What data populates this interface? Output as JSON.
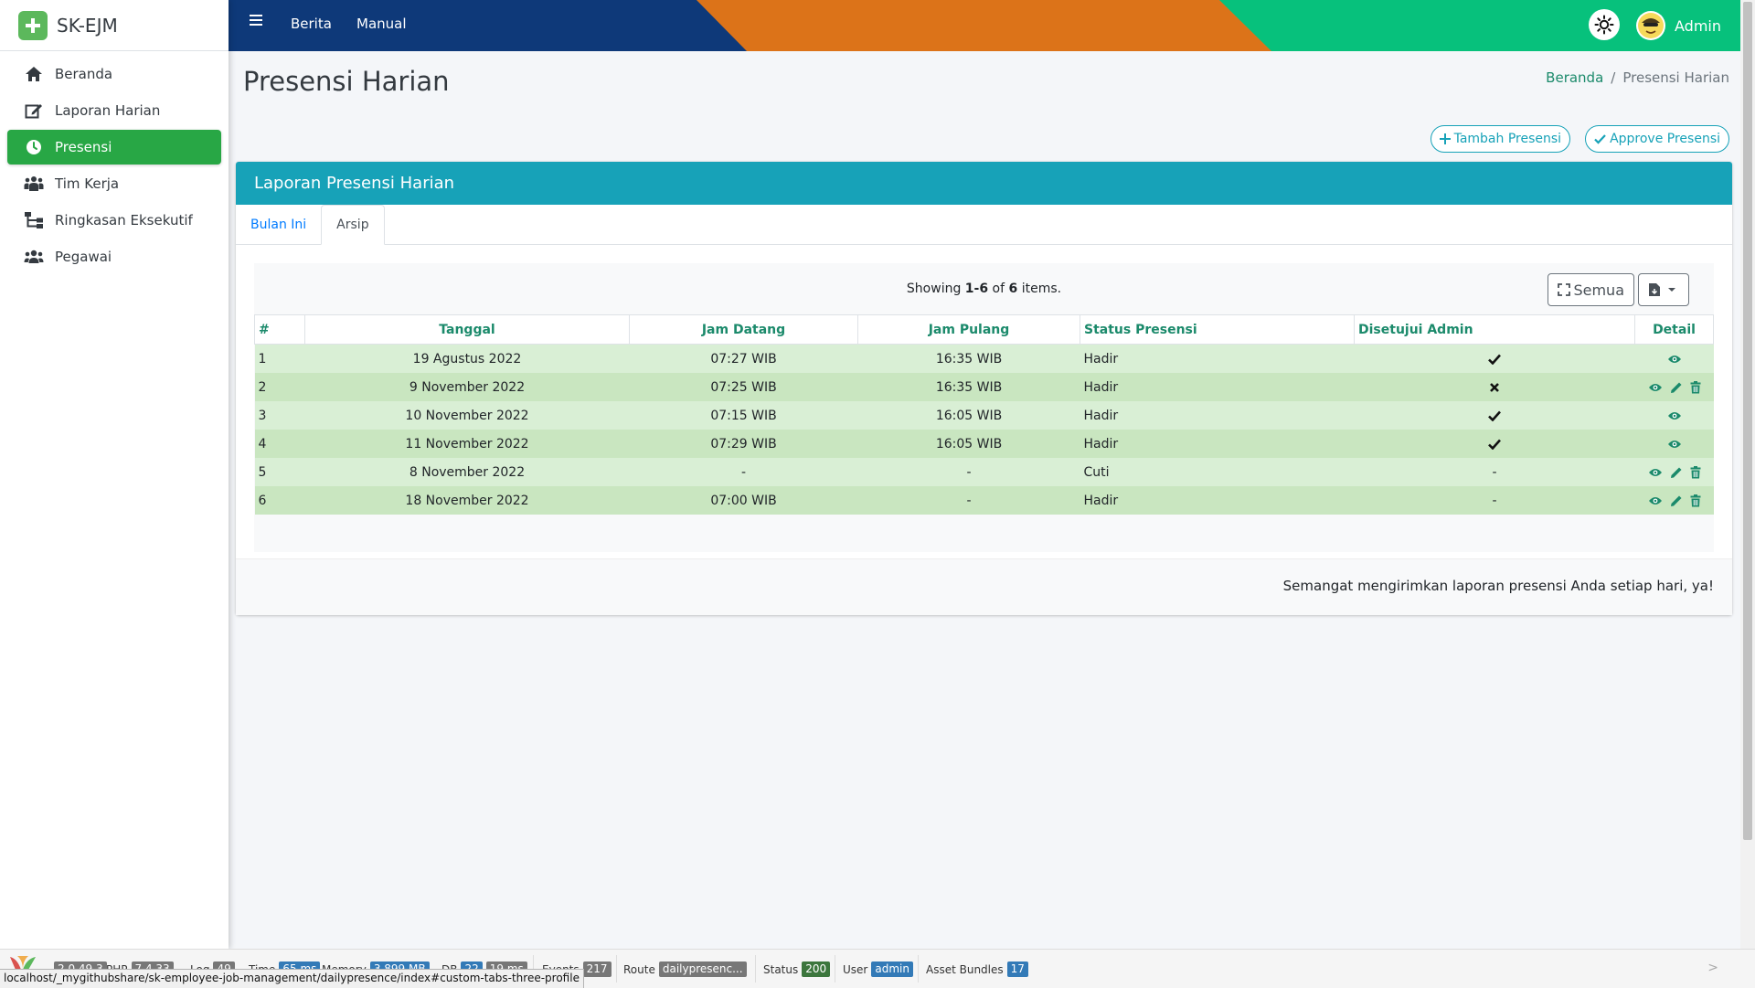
{
  "brand": {
    "name": "SK-EJM"
  },
  "sidebar": {
    "items": [
      {
        "label": "Beranda",
        "icon": "home-icon",
        "active": false
      },
      {
        "label": "Laporan Harian",
        "icon": "edit-icon",
        "active": false
      },
      {
        "label": "Presensi",
        "icon": "clock-icon",
        "active": true
      },
      {
        "label": "Tim Kerja",
        "icon": "team-icon",
        "active": false
      },
      {
        "label": "Ringkasan Eksekutif",
        "icon": "sitemap-icon",
        "active": false
      },
      {
        "label": "Pegawai",
        "icon": "users-icon",
        "active": false
      }
    ]
  },
  "topbar": {
    "links": [
      "Berita",
      "Manual"
    ],
    "user": "Admin",
    "colors": {
      "navy": "#0e3979",
      "orange": "#dc7319",
      "green": "#07c17c"
    }
  },
  "page": {
    "title": "Presensi Harian",
    "breadcrumb": {
      "home": "Beranda",
      "current": "Presensi Harian"
    }
  },
  "actions": {
    "add": "Tambah Presensi",
    "approve": "Approve Presensi"
  },
  "card": {
    "title": "Laporan Presensi Harian",
    "tabs": [
      {
        "label": "Bulan Ini",
        "active": false
      },
      {
        "label": "Arsip",
        "active": true
      }
    ],
    "summary": {
      "prefix": "Showing ",
      "range": "1-6",
      "middle": " of ",
      "total": "6",
      "suffix": " items."
    },
    "toolbar": {
      "all_label": "Semua"
    },
    "footer_note": "Semangat mengirimkan laporan presensi Anda setiap hari, ya!"
  },
  "table": {
    "columns": [
      "#",
      "Tanggal",
      "Jam Datang",
      "Jam Pulang",
      "Status Presensi",
      "Disetujui Admin",
      "Detail"
    ],
    "rows": [
      {
        "no": "1",
        "tanggal": "19 Agustus 2022",
        "datang": "07:27 WIB",
        "pulang": "16:35 WIB",
        "status": "Hadir",
        "approved": "check",
        "actions": [
          "view"
        ]
      },
      {
        "no": "2",
        "tanggal": "9 November 2022",
        "datang": "07:25 WIB",
        "pulang": "16:35 WIB",
        "status": "Hadir",
        "approved": "cross",
        "actions": [
          "view",
          "edit",
          "delete"
        ]
      },
      {
        "no": "3",
        "tanggal": "10 November 2022",
        "datang": "07:15 WIB",
        "pulang": "16:05 WIB",
        "status": "Hadir",
        "approved": "check",
        "actions": [
          "view"
        ]
      },
      {
        "no": "4",
        "tanggal": "11 November 2022",
        "datang": "07:29 WIB",
        "pulang": "16:05 WIB",
        "status": "Hadir",
        "approved": "check",
        "actions": [
          "view"
        ]
      },
      {
        "no": "5",
        "tanggal": "8 November 2022",
        "datang": "-",
        "pulang": "-",
        "status": "Cuti",
        "approved": "-",
        "actions": [
          "view",
          "edit",
          "delete"
        ]
      },
      {
        "no": "6",
        "tanggal": "18 November 2022",
        "datang": "07:00 WIB",
        "pulang": "-",
        "status": "Hadir",
        "approved": "-",
        "actions": [
          "view",
          "edit",
          "delete"
        ]
      }
    ]
  },
  "debugbar": {
    "yii": "2.0.49.3",
    "php_label": "PHP",
    "php": "7.4.33",
    "log_label": "Log",
    "log": "49",
    "time_label": "Time",
    "time": "65 ms",
    "memory_label": "Memory",
    "memory": "3.899 MB",
    "db_label": "DB",
    "db_count": "22",
    "db_time": "19 ms",
    "events_label": "Events",
    "events": "217",
    "route_label": "Route",
    "route": "dailypresenc...",
    "status_label": "Status",
    "status": "200",
    "user_label": "User",
    "user": "admin",
    "asset_label": "Asset Bundles",
    "asset": "17"
  },
  "statusbar": {
    "url": "localhost/_mygithubshare/sk-employee-job-management/dailypresence/index#custom-tabs-three-profile"
  }
}
